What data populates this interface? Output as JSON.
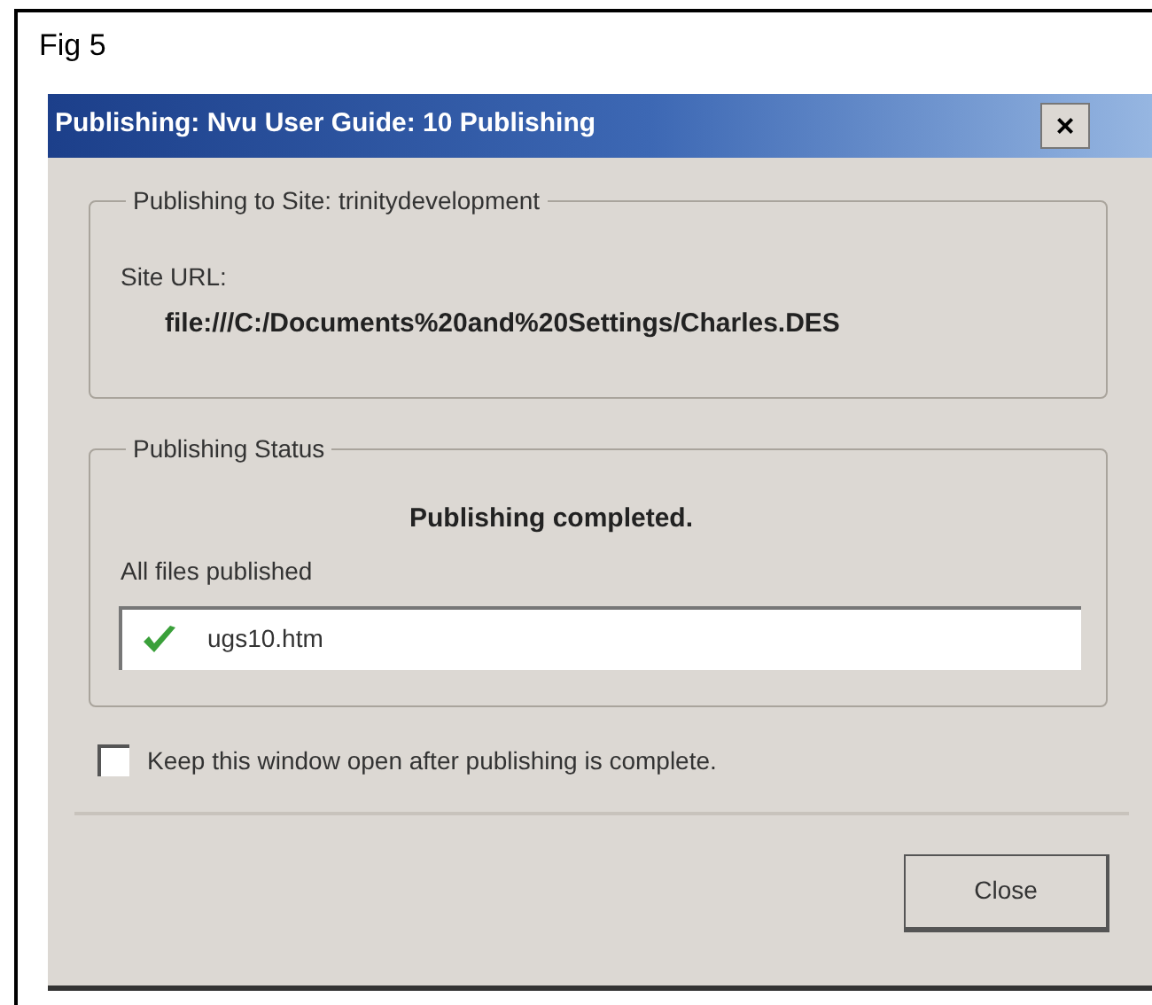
{
  "figure_label": "Fig 5",
  "window": {
    "title": "Publishing: Nvu User Guide: 10 Publishing",
    "close_glyph": "×"
  },
  "site_group": {
    "legend": "Publishing to Site: trinitydevelopment",
    "url_label": "Site URL:",
    "url": "file:///C:/Documents%20and%20Settings/Charles.DES"
  },
  "status_group": {
    "legend": "Publishing Status",
    "message": "Publishing completed.",
    "summary": "All files published",
    "files": [
      {
        "name": "ugs10.htm",
        "published": true
      }
    ]
  },
  "keep_open": {
    "label": "Keep this window open after publishing is complete.",
    "checked": false
  },
  "buttons": [
    "Close"
  ]
}
